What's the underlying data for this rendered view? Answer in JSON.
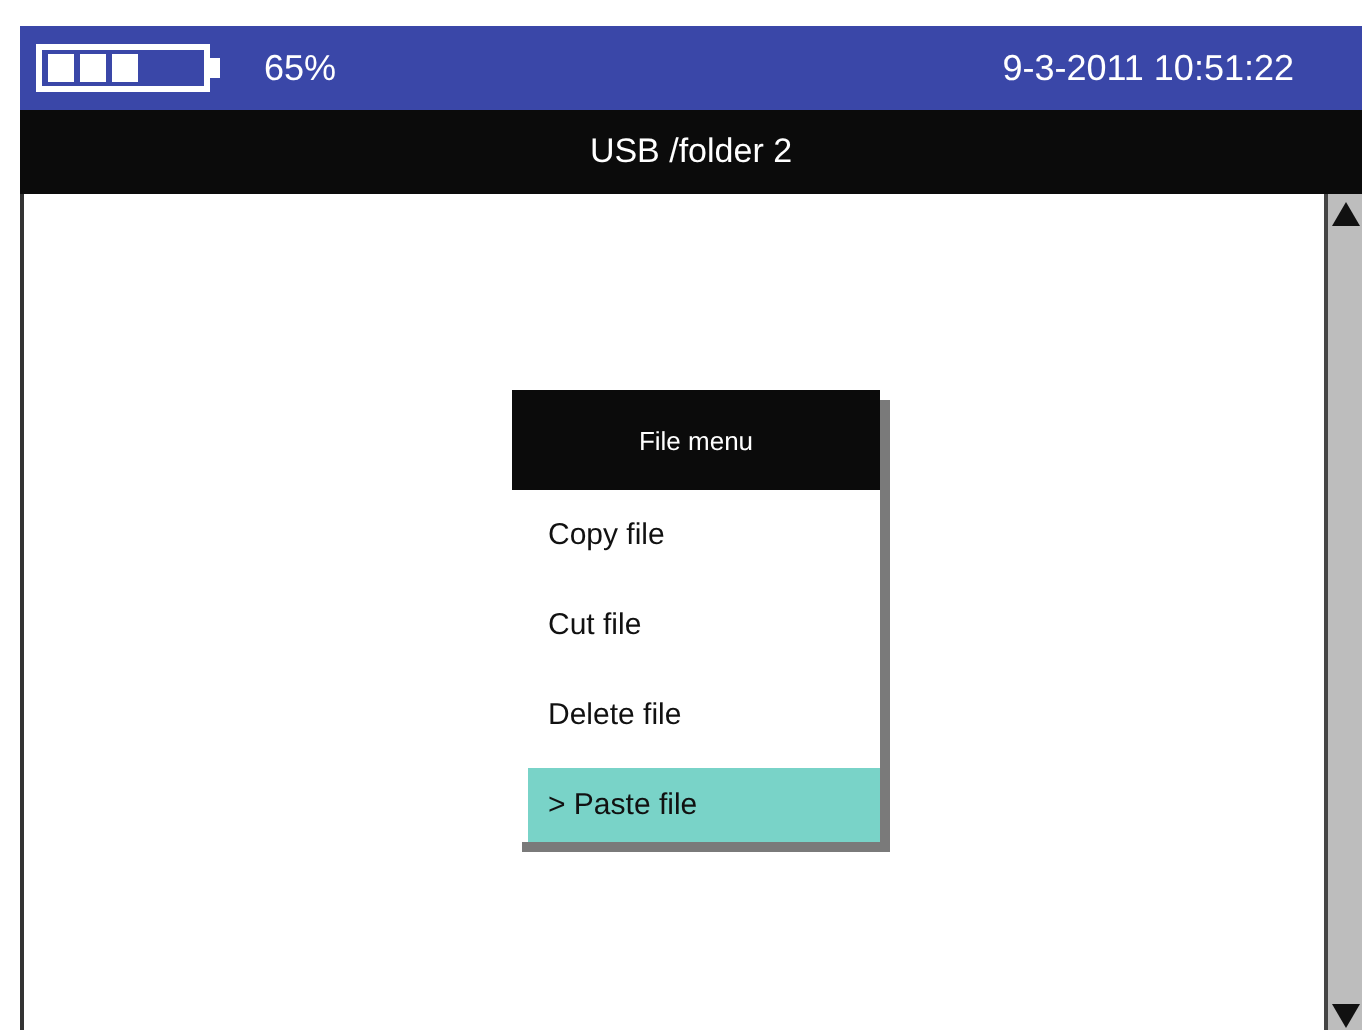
{
  "status_bar": {
    "battery_percent": "65%",
    "datetime": "9-3-2011 10:51:22"
  },
  "title_bar": {
    "title": "USB /folder 2"
  },
  "file_menu": {
    "title": "File menu",
    "items": [
      {
        "label": "Copy file",
        "selected": false
      },
      {
        "label": "Cut file",
        "selected": false
      },
      {
        "label": "Delete file",
        "selected": false
      },
      {
        "label": "> Paste file",
        "selected": true
      }
    ]
  }
}
